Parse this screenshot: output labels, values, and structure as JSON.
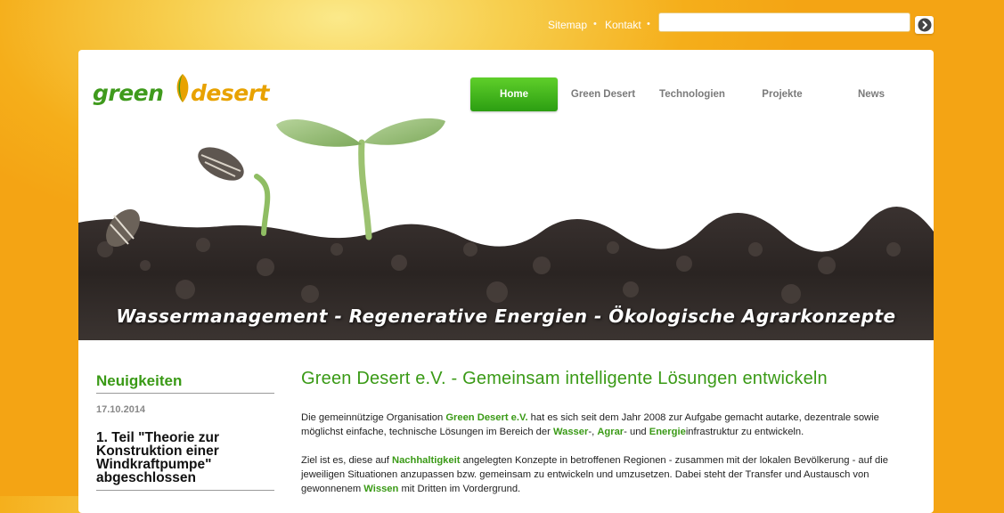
{
  "topbar": {
    "sitemap": "Sitemap",
    "kontakt": "Kontakt",
    "separator": "•",
    "search_value": ""
  },
  "logo": {
    "word1": "green",
    "word2": "desert"
  },
  "nav": {
    "items": [
      {
        "label": "Home",
        "active": true
      },
      {
        "label": "Green Desert",
        "active": false
      },
      {
        "label": "Technologien",
        "active": false
      },
      {
        "label": "Projekte",
        "active": false
      },
      {
        "label": "News",
        "active": false
      }
    ]
  },
  "hero": {
    "caption": "Wassermanagement - Regenerative Energien - Ökologische Agrarkonzepte"
  },
  "sidebar": {
    "heading": "Neuigkeiten",
    "news": [
      {
        "date": "17.10.2014",
        "title": "1. Teil \"Theorie zur Konstruktion einer Windkraftpumpe\" abgeschlossen"
      }
    ]
  },
  "main": {
    "title": "Green Desert e.V. - Gemeinsam intelligente Lösungen entwickeln",
    "p1": {
      "t1": "Die gemeinnützige Organisation ",
      "h1": "Green Desert e.V.",
      "t2": " hat es sich seit dem Jahr 2008 zur Aufgabe gemacht autarke, dezentrale sowie möglichst einfache, technische Lösungen im Bereich der ",
      "h2": "Wasser",
      "t3": "-, ",
      "h3": "Agrar",
      "t4": "- und ",
      "h4": "Energie",
      "t5": "infrastruktur zu entwickeln."
    },
    "p2": {
      "t1": "Ziel ist es, diese auf ",
      "h1": "Nachhaltigkeit",
      "t2": " angelegten Konzepte in betroffenen Regionen - zusammen mit der lokalen Bevölkerung - auf die jeweiligen Situationen anzupassen bzw. gemeinsam zu entwickeln und umzusetzen. Dabei steht der Transfer und Austausch von gewonnenem ",
      "h2": "Wissen",
      "t3": " mit Dritten im Vordergrund."
    }
  },
  "colors": {
    "brand_green": "#3a9a16",
    "brand_orange": "#f4a414",
    "nav_active": "#3fb41a"
  },
  "icons": {
    "search_submit": "chevron-right-icon",
    "logo_leaf": "leaf-icon"
  }
}
